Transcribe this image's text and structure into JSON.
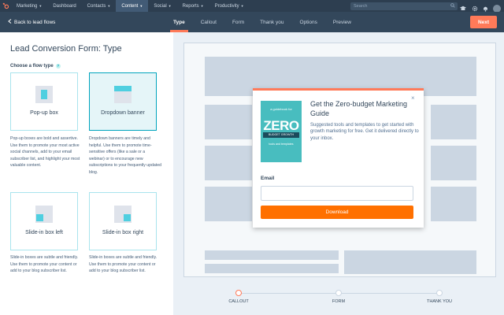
{
  "topnav": {
    "items": [
      {
        "label": "Marketing",
        "active": false
      },
      {
        "label": "Dashboard",
        "active": false
      },
      {
        "label": "Contacts",
        "active": false,
        "caret": true
      },
      {
        "label": "Content",
        "active": true,
        "caret": true
      },
      {
        "label": "Social",
        "active": false,
        "caret": true
      },
      {
        "label": "Reports",
        "active": false,
        "caret": true
      },
      {
        "label": "Productivity",
        "active": false,
        "caret": true
      }
    ],
    "search_placeholder": "Search"
  },
  "subnav": {
    "back_label": "Back to lead flows",
    "tabs": [
      "Type",
      "Callout",
      "Form",
      "Thank you",
      "Options",
      "Preview"
    ],
    "active_tab": "Type",
    "next_label": "Next"
  },
  "left": {
    "title": "Lead Conversion Form: Type",
    "subtitle": "Choose a flow type",
    "help": "?",
    "cards": [
      {
        "label": "Pop-up box",
        "selected": false,
        "desc": "Pop-up boxes are bold and assertive. Use them to promote your most active social channels, add to your email subscriber list, and highlight your most valuable content."
      },
      {
        "label": "Dropdown banner",
        "selected": true,
        "desc": "Dropdown banners are timely and helpful. Use them to promote time-sensitive offers (like a sale or a webinar) or to encourage new subscriptions to your frequently updated blog."
      },
      {
        "label": "Slide-in box left",
        "selected": false,
        "desc": "Slide-in boxes are subtle and friendly. Use them to promote your content or add to your blog subscriber list."
      },
      {
        "label": "Slide-in box right",
        "selected": false,
        "desc": "Slide-in boxes are subtle and friendly. Use them to promote your content or add to your blog subscriber list."
      }
    ]
  },
  "modal": {
    "close": "×",
    "book": {
      "top_text": "a guidebook for",
      "big_text": "ZERO",
      "band_text": "BUDGET GROWTH",
      "bottom_text": "tools and templates"
    },
    "title": "Get the Zero-budget Marketing Guide",
    "body": "Suggested tools and templates to get started with growth marketing for free. Get it delivered directly to your inbox.",
    "email_label": "Email",
    "download_label": "Download"
  },
  "progress": {
    "steps": [
      "CALLOUT",
      "FORM",
      "THANK YOU"
    ],
    "current": 0
  },
  "colors": {
    "accent": "#ff7a59",
    "download": "#ff7000",
    "teal": "#00a4bd",
    "nav_dark": "#2d3e50"
  }
}
